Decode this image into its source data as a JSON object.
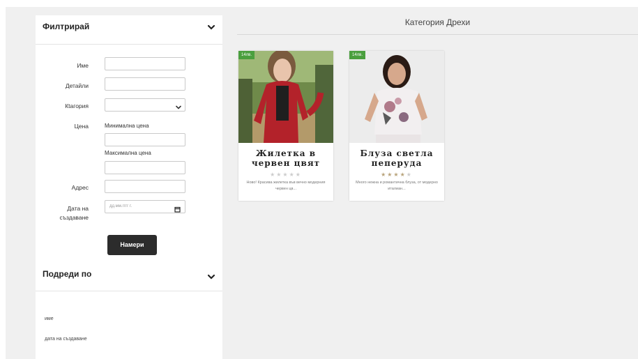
{
  "filter": {
    "title": "Филтрирай",
    "fields": {
      "name_label": "Име",
      "details_label": "Детайли",
      "category_label": "Кtагория",
      "price_label": "Цена",
      "min_price_label": "Минимална цена",
      "max_price_label": "Максимална цена",
      "address_label": "Адрес",
      "date_label": "Дата на създаване",
      "date_placeholder": "дд.мм.гггг г.",
      "name_value": "",
      "details_value": "",
      "category_value": "",
      "min_price_value": "",
      "max_price_value": "",
      "address_value": ""
    },
    "search_button": "Намери"
  },
  "sort": {
    "title": "Подреди по",
    "options": [
      "име",
      "дата на създаване"
    ]
  },
  "main": {
    "category_title": "Категория Дрехи"
  },
  "products": [
    {
      "price": "14лв.",
      "title": "Жилетка в червен цвят",
      "rating": 0,
      "max_rating": 5,
      "description": "Ново! Красива жилетка във вечно модерния червен цв..."
    },
    {
      "price": "14лв.",
      "title": "Блуза светла пеперуда",
      "rating": 4,
      "max_rating": 5,
      "description": "Много нежна и романтична блуза, от модерно италиан..."
    }
  ],
  "colors": {
    "price_badge": "#4a9f3e",
    "search_button": "#2c2c2c",
    "page_background": "#f0f0f0"
  }
}
